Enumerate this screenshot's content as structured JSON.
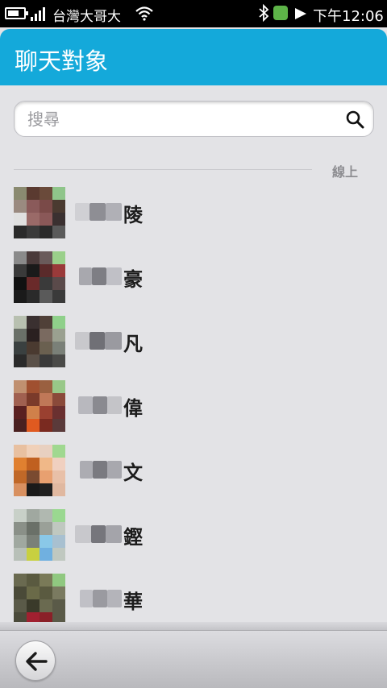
{
  "statusbar": {
    "carrier": "台灣大哥大",
    "time": "下午12:06",
    "battery_level": 0.7,
    "signal_bars": 4
  },
  "header": {
    "title": "聊天對象"
  },
  "search": {
    "placeholder": "搜尋"
  },
  "section": {
    "label": "線上"
  },
  "contacts": [
    {
      "name_char": "陵"
    },
    {
      "name_char": "豪"
    },
    {
      "name_char": "凡"
    },
    {
      "name_char": "偉"
    },
    {
      "name_char": "文"
    },
    {
      "name_char": "鏗"
    },
    {
      "name_char": "華"
    }
  ],
  "colors": {
    "accent": "#14a9da",
    "background": "#e3e3e6"
  },
  "icons": {
    "search": "search-icon",
    "back": "back-arrow-icon",
    "bluetooth": "bluetooth-icon",
    "wifi": "wifi-icon"
  }
}
